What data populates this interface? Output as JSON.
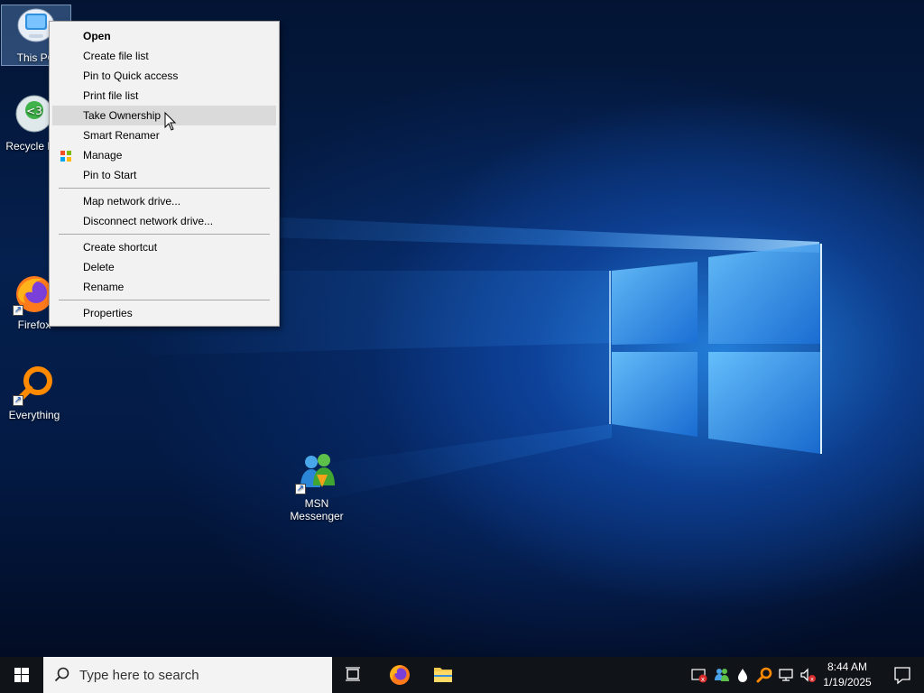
{
  "desktop": {
    "icons": {
      "this_pc": "This PC",
      "recycle_bin": "Recycle Bin",
      "firefox": "Firefox",
      "everything": "Everything",
      "msn": "MSN Messenger"
    }
  },
  "context_menu": {
    "items": [
      {
        "label": "Open"
      },
      {
        "label": "Create file list"
      },
      {
        "label": "Pin to Quick access"
      },
      {
        "label": "Print file list"
      },
      {
        "label": "Take Ownership"
      },
      {
        "label": "Smart Renamer"
      },
      {
        "label": "Manage"
      },
      {
        "label": "Pin to Start"
      },
      {
        "label": "Map network drive..."
      },
      {
        "label": "Disconnect network drive..."
      },
      {
        "label": "Create shortcut"
      },
      {
        "label": "Delete"
      },
      {
        "label": "Rename"
      },
      {
        "label": "Properties"
      }
    ]
  },
  "taskbar": {
    "search_placeholder": "Type here to search",
    "clock_time": "8:44 AM",
    "clock_date": "1/19/2025"
  },
  "colors": {
    "taskbar": "#101318",
    "menu_bg": "#f2f2f2",
    "menu_hover": "#dadada",
    "accent": "#0078d7"
  }
}
